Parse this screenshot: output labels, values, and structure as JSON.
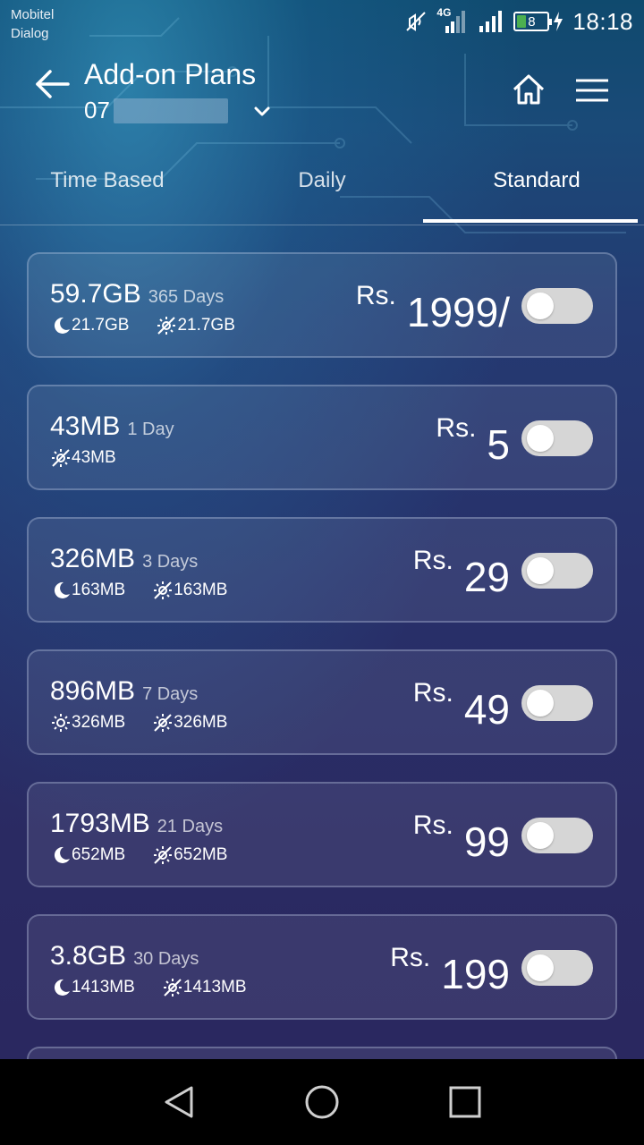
{
  "status_bar": {
    "carriers": [
      "Mobitel",
      "Dialog"
    ],
    "network": "4G",
    "battery": "8",
    "time": "18:18"
  },
  "header": {
    "title": "Add-on Plans",
    "number_prefix": "07",
    "icons": {
      "back": "back-arrow-icon",
      "dropdown": "chevron-down-icon",
      "home": "home-icon",
      "menu": "hamburger-menu-icon"
    }
  },
  "tabs": [
    {
      "label": "Time Based",
      "active": false
    },
    {
      "label": "Daily",
      "active": false
    },
    {
      "label": "Standard",
      "active": true
    }
  ],
  "plans": [
    {
      "volume": "59.7GB",
      "validity": "365 Days",
      "details": [
        {
          "icon": "moon-icon",
          "value": "21.7GB"
        },
        {
          "icon": "no-sun-icon",
          "value": "21.7GB"
        }
      ],
      "currency": "Rs.",
      "price": "1999/",
      "enabled": false
    },
    {
      "volume": "43MB",
      "validity": "1 Day",
      "details": [
        {
          "icon": "no-sun-icon",
          "value": "43MB"
        }
      ],
      "currency": "Rs.",
      "price": "5",
      "enabled": false
    },
    {
      "volume": "326MB",
      "validity": "3 Days",
      "details": [
        {
          "icon": "moon-icon",
          "value": "163MB"
        },
        {
          "icon": "no-sun-icon",
          "value": "163MB"
        }
      ],
      "currency": "Rs.",
      "price": "29",
      "enabled": false
    },
    {
      "volume": "896MB",
      "validity": "7 Days",
      "details": [
        {
          "icon": "sun-icon",
          "value": "326MB"
        },
        {
          "icon": "no-sun-icon",
          "value": "326MB"
        }
      ],
      "currency": "Rs.",
      "price": "49",
      "enabled": false
    },
    {
      "volume": "1793MB",
      "validity": "21 Days",
      "details": [
        {
          "icon": "moon-icon",
          "value": "652MB"
        },
        {
          "icon": "no-sun-icon",
          "value": "652MB"
        }
      ],
      "currency": "Rs.",
      "price": "99",
      "enabled": false
    },
    {
      "volume": "3.8GB",
      "validity": "30 Days",
      "details": [
        {
          "icon": "moon-icon",
          "value": "1413MB"
        },
        {
          "icon": "no-sun-icon",
          "value": "1413MB"
        }
      ],
      "currency": "Rs.",
      "price": "199",
      "enabled": false
    }
  ],
  "nav": {
    "back": "triangle-back-icon",
    "home": "circle-home-icon",
    "recents": "square-recents-icon"
  },
  "colors": {
    "accent": "#ffffff",
    "toggle_off": "#d6d6d6",
    "background_top": "#0f4a6e",
    "background_bottom": "#2a2860"
  }
}
